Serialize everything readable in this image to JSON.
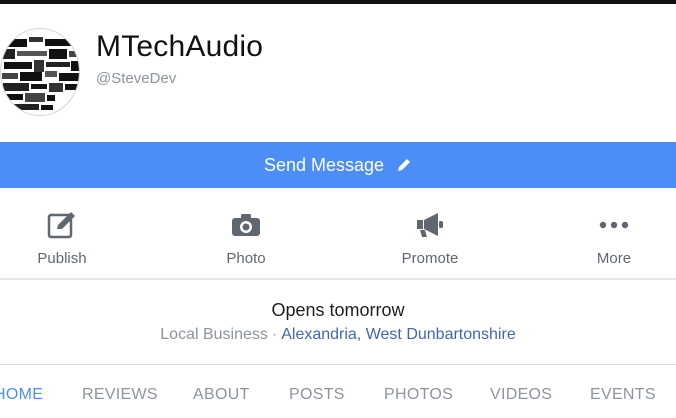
{
  "page": {
    "name": "MTechAudio",
    "handle": "@SteveDev"
  },
  "send_message": {
    "label": "Send Message"
  },
  "actions": [
    {
      "label": "Publish",
      "icon": "edit-icon"
    },
    {
      "label": "Photo",
      "icon": "camera-icon"
    },
    {
      "label": "Promote",
      "icon": "megaphone-icon"
    },
    {
      "label": "More",
      "icon": "more-dots-icon"
    }
  ],
  "info": {
    "hours": "Opens tomorrow",
    "category": "Local Business",
    "separator": "·",
    "location": "Alexandria, West Dunbartonshire"
  },
  "tabs": [
    {
      "label": "HOME",
      "active": true
    },
    {
      "label": "REVIEWS",
      "active": false
    },
    {
      "label": "ABOUT",
      "active": false
    },
    {
      "label": "POSTS",
      "active": false
    },
    {
      "label": "PHOTOS",
      "active": false
    },
    {
      "label": "VIDEOS",
      "active": false
    },
    {
      "label": "EVENTS",
      "active": false
    }
  ],
  "colors": {
    "accent": "#4c8ef7",
    "link": "#4267b2",
    "muted": "#8d949e",
    "icon": "#606770"
  }
}
